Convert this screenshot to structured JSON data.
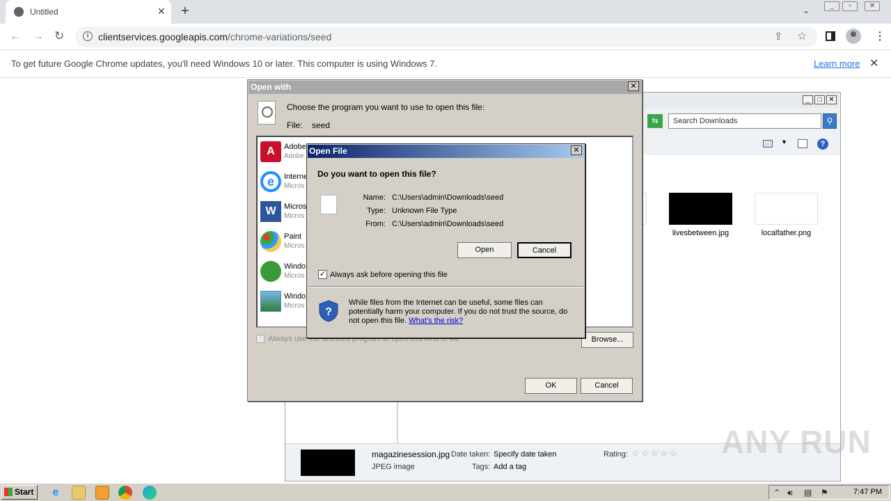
{
  "browser": {
    "tab_title": "Untitled",
    "tab_close": "✕",
    "new_tab": "+",
    "tab_search": "⌄",
    "url_host": "clientservices.googleapis.com",
    "url_path": "/chrome-variations/seed",
    "icons": {
      "back": "back-arrow-icon",
      "forward": "forward-arrow-icon",
      "reload": "reload-icon",
      "share": "share-icon",
      "bookmark": "star-icon",
      "menu": "kebab-menu-icon"
    }
  },
  "infobar": {
    "message": "To get future Google Chrome updates, you'll need Windows 10 or later. This computer is using Windows 7.",
    "link": "Learn more",
    "close": "✕"
  },
  "explorer": {
    "search_placeholder": "Search Downloads",
    "thumbnails": [
      {
        "name": "livesbetween.jpg",
        "color": "#000000"
      },
      {
        "name": "localfather.png",
        "color": "#ffffff"
      }
    ],
    "details": {
      "file_name": "magazinesession.jpg",
      "file_type": "JPEG image",
      "date_taken_label": "Date taken:",
      "date_taken_value": "Specify date taken",
      "tags_label": "Tags:",
      "tags_value": "Add a tag",
      "rating_label": "Rating:",
      "rating_stars": "☆☆☆☆☆"
    }
  },
  "open_with": {
    "title": "Open with",
    "instruction": "Choose the program you want to use to open this file:",
    "file_label": "File:",
    "file_value": "seed",
    "programs": [
      {
        "name": "Adobe",
        "sub": "Adobe",
        "icon": "adobe-reader-icon",
        "color": "#c8102e"
      },
      {
        "name": "Interne",
        "sub": "Micros",
        "icon": "internet-explorer-icon",
        "color": "#1e90ff"
      },
      {
        "name": "Micros",
        "sub": "Micros",
        "icon": "word-icon",
        "color": "#2b579a"
      },
      {
        "name": "Paint",
        "sub": "Micros",
        "icon": "paint-icon",
        "color": "#e8a33c"
      },
      {
        "name": "Windo",
        "sub": "Micros",
        "icon": "windows-media-icon",
        "color": "#3a9a3a"
      },
      {
        "name": "Windo",
        "sub": "Micros",
        "icon": "photo-viewer-icon",
        "color": "#4a8ac8"
      }
    ],
    "always_use": "Always use the selected program to open this kind of file",
    "browse": "Browse...",
    "ok": "OK",
    "cancel": "Cancel"
  },
  "open_file": {
    "title": "Open File",
    "question": "Do you want to open this file?",
    "name_label": "Name:",
    "name_value": "C:\\Users\\admin\\Downloads\\seed",
    "type_label": "Type:",
    "type_value": "Unknown File Type",
    "from_label": "From:",
    "from_value": "C:\\Users\\admin\\Downloads\\seed",
    "open": "Open",
    "cancel": "Cancel",
    "always_ask": "Always ask before opening this file",
    "always_ask_checked": true,
    "warning": "While files from the Internet can be useful, some files can potentially harm your computer. If you do not trust the source, do not open this file.",
    "risk_link": "What's the risk?"
  },
  "taskbar": {
    "start": "Start",
    "time": "7:47 PM"
  },
  "watermark": "ANY RUN"
}
